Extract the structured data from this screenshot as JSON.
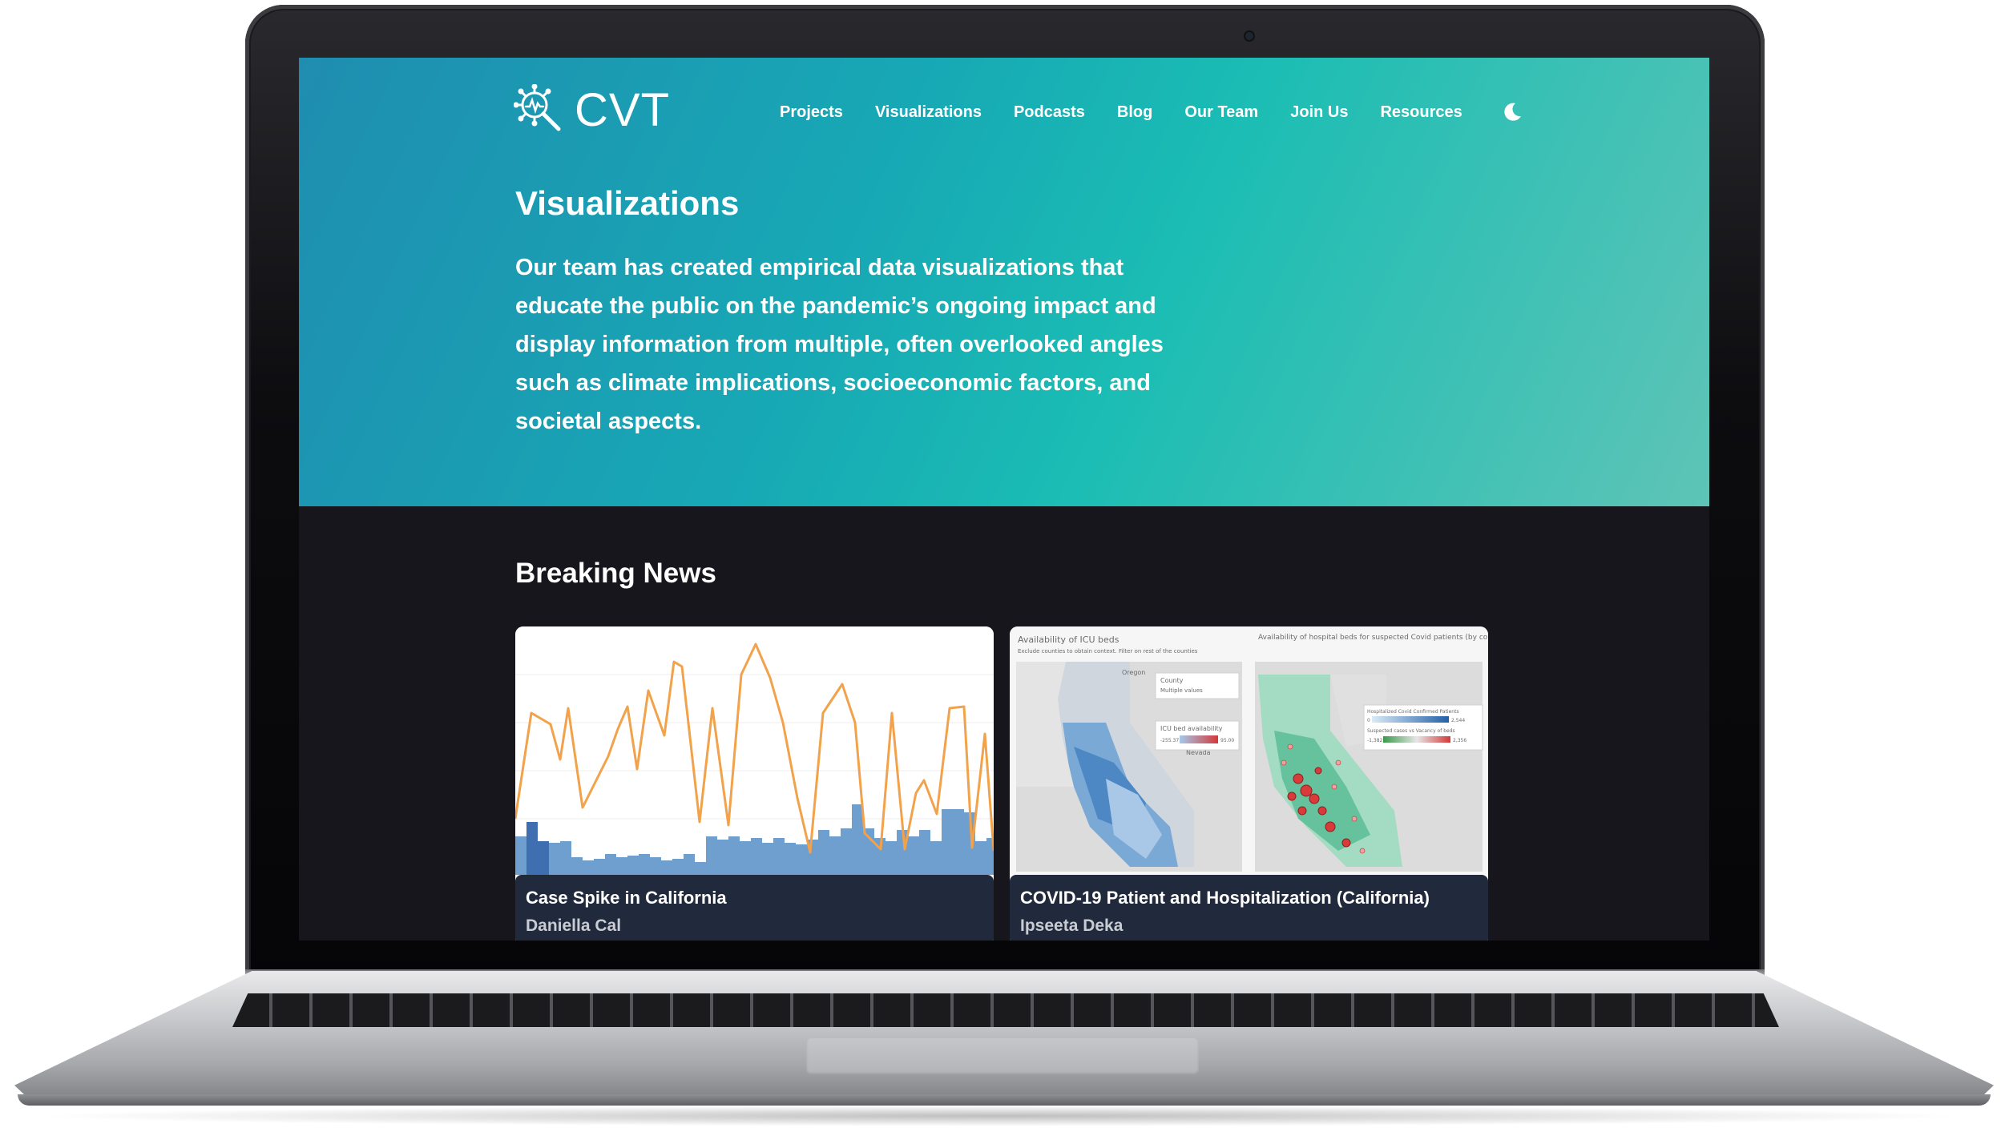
{
  "site": {
    "logo_text": "CVT"
  },
  "nav": {
    "items": [
      {
        "label": "Projects"
      },
      {
        "label": "Visualizations"
      },
      {
        "label": "Podcasts"
      },
      {
        "label": "Blog"
      },
      {
        "label": "Our Team"
      },
      {
        "label": "Join Us"
      },
      {
        "label": "Resources"
      }
    ],
    "theme_toggle_icon": "moon-icon"
  },
  "hero": {
    "title": "Visualizations",
    "description": "Our team has created empirical data visualizations that educate the public on the pandemic’s ongoing impact and display information from multiple, often overlooked angles such as climate implications, socioeconomic factors, and societal aspects."
  },
  "breaking": {
    "title": "Breaking News",
    "cards": [
      {
        "title": "Case Spike in California",
        "author": "Daniella Cal",
        "thumb_type": "bar-and-line chart"
      },
      {
        "title": "COVID-19 Patient and Hospitalization (California)",
        "author": "Ipseeta Deka",
        "thumb_type": "california maps",
        "map_left_title": "Availability of ICU beds",
        "map_left_note": "Exclude counties to obtain context. Filter on rest of the counties",
        "map_right_title": "Availability of hospital beds for suspected Covid patients (by county)",
        "legend_county": "County",
        "legend_county_value": "Multiple values",
        "legend_icu": "ICU bed availability",
        "legend_icu_min": "-255.37",
        "legend_icu_max": "95.00",
        "legend_hosp": "Hospitalized Covid Confirmed Patients",
        "legend_hosp_min": "0",
        "legend_hosp_max": "2,544",
        "legend_susp": "Suspected cases vs Vacancy of beds",
        "legend_susp_min": "-1,382",
        "legend_susp_max": "2,356",
        "map_label_oregon": "Oregon",
        "map_label_nevada": "Nevada"
      }
    ]
  },
  "colors": {
    "hero_gradient_start": "#1f8db0",
    "hero_gradient_end": "#5ec4b6",
    "page_background": "#17161d",
    "card_caption": "#212a3c",
    "chart_line": "#f2a24a",
    "chart_bar": "#6e9fce"
  }
}
